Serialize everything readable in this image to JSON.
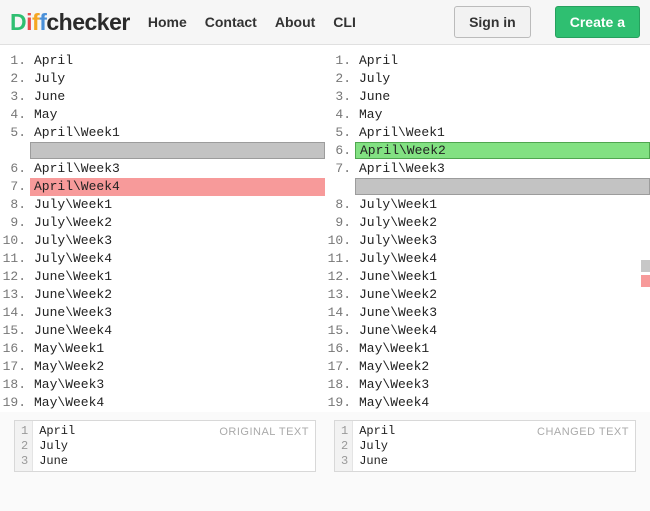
{
  "header": {
    "nav": {
      "home": "Home",
      "contact": "Contact",
      "about": "About",
      "cli": "CLI"
    },
    "sign_in": "Sign in",
    "create": "Create a"
  },
  "logo": {
    "d1": "D",
    "i": "i",
    "f1": "f",
    "f2": "f",
    "rest": "checker"
  },
  "left_lines": [
    {
      "n": "1.",
      "t": "April",
      "cls": ""
    },
    {
      "n": "2.",
      "t": "July",
      "cls": ""
    },
    {
      "n": "3.",
      "t": "June",
      "cls": ""
    },
    {
      "n": "4.",
      "t": "May",
      "cls": ""
    },
    {
      "n": "5.",
      "t": "April\\Week1",
      "cls": ""
    },
    {
      "n": "",
      "t": "",
      "cls": "grey box"
    },
    {
      "n": "6.",
      "t": "April\\Week3",
      "cls": ""
    },
    {
      "n": "7.",
      "t": "April\\Week4",
      "cls": "red"
    },
    {
      "n": "8.",
      "t": "July\\Week1",
      "cls": ""
    },
    {
      "n": "9.",
      "t": "July\\Week2",
      "cls": ""
    },
    {
      "n": "10.",
      "t": "July\\Week3",
      "cls": ""
    },
    {
      "n": "11.",
      "t": "July\\Week4",
      "cls": ""
    },
    {
      "n": "12.",
      "t": "June\\Week1",
      "cls": ""
    },
    {
      "n": "13.",
      "t": "June\\Week2",
      "cls": ""
    },
    {
      "n": "14.",
      "t": "June\\Week3",
      "cls": ""
    },
    {
      "n": "15.",
      "t": "June\\Week4",
      "cls": ""
    },
    {
      "n": "16.",
      "t": "May\\Week1",
      "cls": ""
    },
    {
      "n": "17.",
      "t": "May\\Week2",
      "cls": ""
    },
    {
      "n": "18.",
      "t": "May\\Week3",
      "cls": ""
    },
    {
      "n": "19.",
      "t": "May\\Week4",
      "cls": ""
    }
  ],
  "right_lines": [
    {
      "n": "1.",
      "t": "April",
      "cls": ""
    },
    {
      "n": "2.",
      "t": "July",
      "cls": ""
    },
    {
      "n": "3.",
      "t": "June",
      "cls": ""
    },
    {
      "n": "4.",
      "t": "May",
      "cls": ""
    },
    {
      "n": "5.",
      "t": "April\\Week1",
      "cls": ""
    },
    {
      "n": "6.",
      "t": "April\\Week2",
      "cls": "green"
    },
    {
      "n": "7.",
      "t": "April\\Week3",
      "cls": ""
    },
    {
      "n": "",
      "t": "",
      "cls": "grey box"
    },
    {
      "n": "8.",
      "t": "July\\Week1",
      "cls": ""
    },
    {
      "n": "9.",
      "t": "July\\Week2",
      "cls": ""
    },
    {
      "n": "10.",
      "t": "July\\Week3",
      "cls": ""
    },
    {
      "n": "11.",
      "t": "July\\Week4",
      "cls": ""
    },
    {
      "n": "12.",
      "t": "June\\Week1",
      "cls": ""
    },
    {
      "n": "13.",
      "t": "June\\Week2",
      "cls": ""
    },
    {
      "n": "14.",
      "t": "June\\Week3",
      "cls": ""
    },
    {
      "n": "15.",
      "t": "June\\Week4",
      "cls": ""
    },
    {
      "n": "16.",
      "t": "May\\Week1",
      "cls": ""
    },
    {
      "n": "17.",
      "t": "May\\Week2",
      "cls": ""
    },
    {
      "n": "18.",
      "t": "May\\Week3",
      "cls": ""
    },
    {
      "n": "19.",
      "t": "May\\Week4",
      "cls": ""
    }
  ],
  "bottom": {
    "original_label": "ORIGINAL TEXT",
    "changed_label": "CHANGED TEXT",
    "gutter": [
      "1",
      "2",
      "3"
    ],
    "preview": [
      "April",
      "July",
      "June"
    ]
  }
}
